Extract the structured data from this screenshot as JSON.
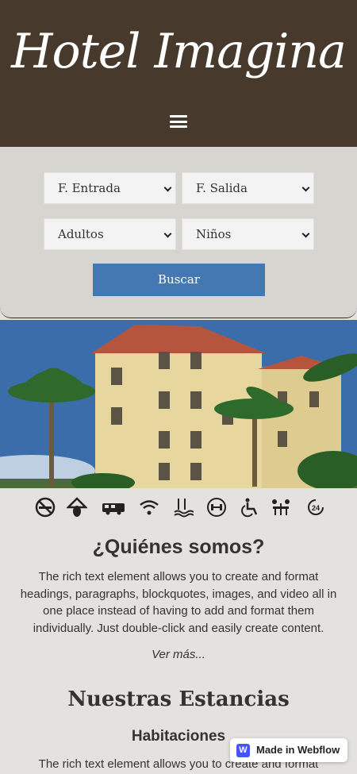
{
  "header": {
    "logo": "Hotel Imagina",
    "menu_icon": "hamburger-menu-icon"
  },
  "booking": {
    "checkin_label": "F. Entrada",
    "checkout_label": "F. Salida",
    "adults_label": "Adultos",
    "children_label": "Niños",
    "search_label": "Buscar"
  },
  "amenities": [
    "no-smoking-icon",
    "pet-friendly-icon",
    "shuttle-bus-icon",
    "wifi-icon",
    "pool-icon",
    "gym-icon",
    "accessible-icon",
    "restaurant-icon",
    "24h-service-icon"
  ],
  "about": {
    "title": "¿Quiénes somos?",
    "text": "The rich text element allows you to create and format headings, paragraphs, blockquotes, images, and video all in one place instead of having to add and format them individually. Just double-click and easily create content.",
    "more": "Ver más..."
  },
  "rooms": {
    "title": "Nuestras Estancias",
    "subtitle": "Habitaciones",
    "text": "The rich text element allows you to create and format"
  },
  "webflow_badge": {
    "label": "Made in Webflow",
    "logo": "W"
  },
  "colors": {
    "header_bg": "#47392c",
    "booking_bg": "#d6d5d0",
    "button_bg": "#4378b3",
    "page_bg": "#e4e2de"
  }
}
